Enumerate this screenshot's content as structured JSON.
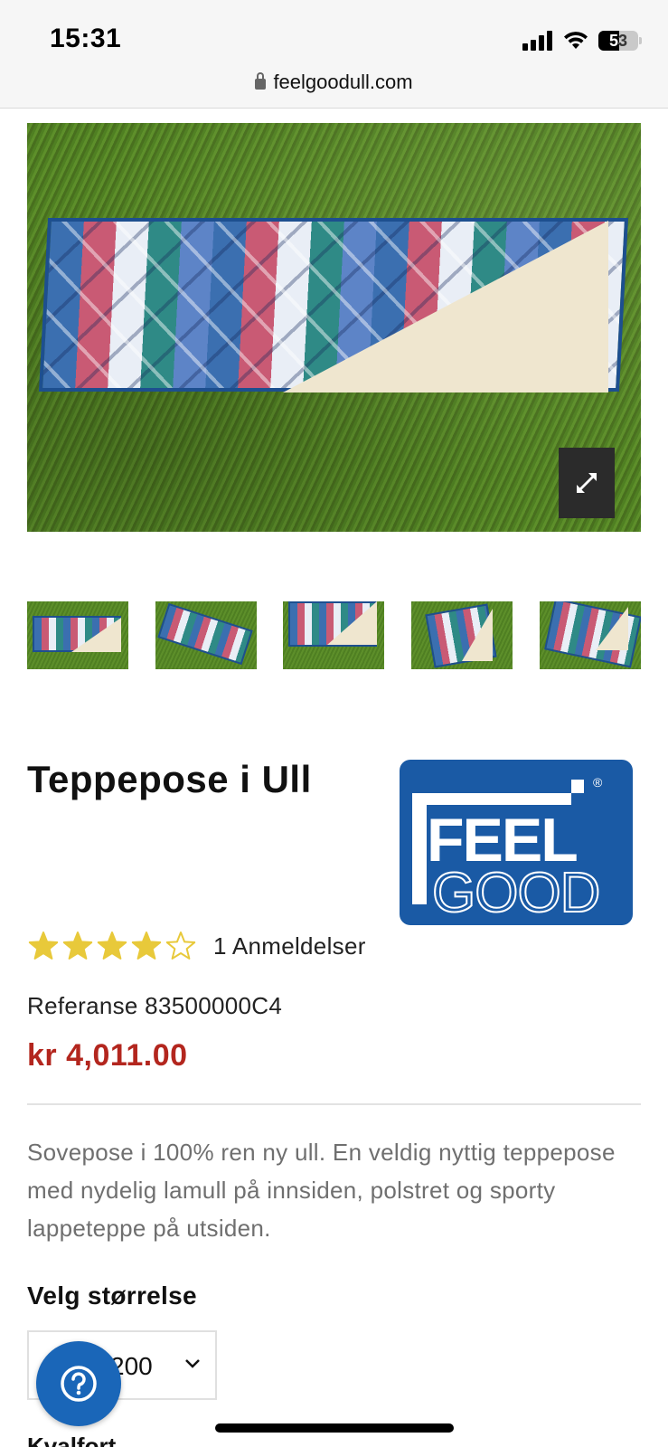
{
  "status_bar": {
    "time": "15:31",
    "battery": "53",
    "battery_level": 0.53,
    "icons": [
      "signal-icon",
      "wifi-icon",
      "battery-icon"
    ]
  },
  "browser": {
    "url": "feelgoodull.com"
  },
  "gallery": {
    "expand_icon": "expand-icon",
    "thumbnail_count": 5
  },
  "product": {
    "title": "Teppepose i Ull",
    "brand_logo": {
      "line1": "FEEL",
      "line2": "GOOD",
      "registered": "®",
      "color": "#1a5aa5"
    },
    "rating": {
      "value": 4,
      "max": 5,
      "reviews_label": "1 Anmeldelser",
      "star_color": "#e8c93a"
    },
    "reference": "Referanse 83500000C4",
    "price": "kr 4,011.00",
    "price_color": "#b3261e",
    "description": "Sovepose i 100% ren ny ull. En veldig nyttig teppepose med nydelig lamull på innsiden, polstret og sporty lappeteppe på utsiden.",
    "size_label": "Velg størrelse",
    "size_value": "200",
    "next_label": "Kvalfort"
  },
  "help": {
    "icon": "question-icon",
    "color": "#1a66b8"
  }
}
